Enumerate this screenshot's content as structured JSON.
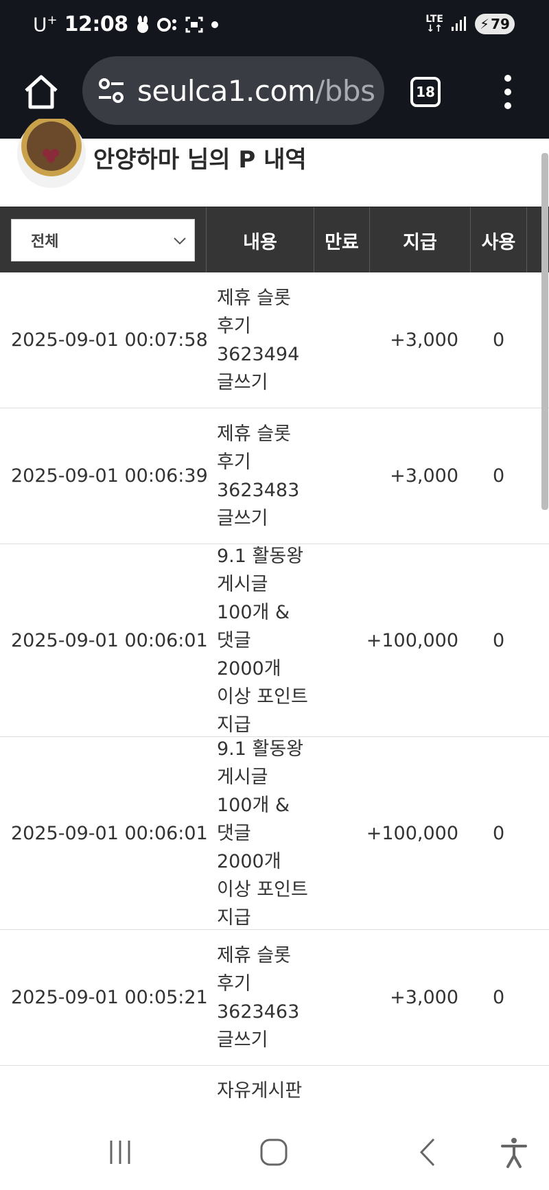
{
  "status": {
    "carrier": "U",
    "carrier_sup": "+",
    "time": "12:08",
    "network": "LTE",
    "battery": "79"
  },
  "browser": {
    "url_main": "seulca1.com",
    "url_path": "/bbs",
    "tab_count": "18"
  },
  "page": {
    "title": "안양하마 님의 P 내역"
  },
  "table": {
    "filter": {
      "selected": "전체"
    },
    "headers": {
      "content": "내용",
      "expire": "만료",
      "pay": "지급",
      "use": "사용"
    },
    "rows": [
      {
        "date": "2025-09-01 00:07:58",
        "content": "제휴 슬롯 후기 3623494 글쓰기",
        "pay": "+3,000",
        "use": "0"
      },
      {
        "date": "2025-09-01 00:06:39",
        "content": "제휴 슬롯 후기 3623483 글쓰기",
        "pay": "+3,000",
        "use": "0"
      },
      {
        "date": "2025-09-01 00:06:01",
        "content": "9.1 활동왕 게시글 100개 & 댓글 2000개 이상 포인트 지급",
        "pay": "+100,000",
        "use": "0"
      },
      {
        "date": "2025-09-01 00:06:01",
        "content": "9.1 활동왕 게시글 100개 & 댓글 2000개 이상 포인트 지급",
        "pay": "+100,000",
        "use": "0"
      },
      {
        "date": "2025-09-01 00:05:21",
        "content": "제휴 슬롯 후기 3623463 글쓰기",
        "pay": "+3,000",
        "use": "0"
      },
      {
        "date": "",
        "content": "자유게시판",
        "pay": "",
        "use": ""
      }
    ]
  },
  "icons": {
    "home": "home-icon",
    "site_info": "tune-icon",
    "tabs": "tabs-icon",
    "menu": "more-vert-icon",
    "recents": "recents-icon",
    "nav_home": "nav-home-icon",
    "back": "back-icon",
    "accessibility": "accessibility-icon"
  }
}
